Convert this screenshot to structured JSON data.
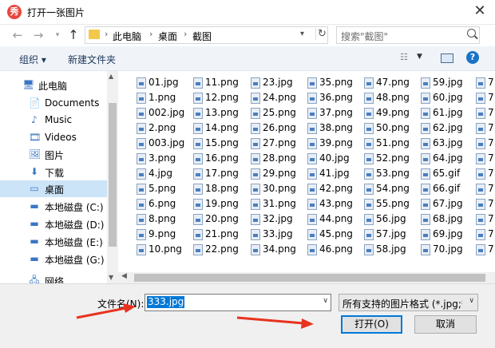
{
  "window": {
    "title": "打开一张图片",
    "app_icon_char": "秀",
    "close_glyph": "✕"
  },
  "address": {
    "crumbs": [
      "此电脑",
      "桌面",
      "截图"
    ]
  },
  "search": {
    "placeholder": "搜索\"截图\""
  },
  "toolbar": {
    "organize": "组织 ▾",
    "new_folder": "新建文件夹",
    "help": "?"
  },
  "sidebar": {
    "items": [
      {
        "label": "此电脑",
        "icon": "computer-icon",
        "glyph": "🖥"
      },
      {
        "label": "Documents",
        "icon": "document-icon",
        "glyph": "📄"
      },
      {
        "label": "Music",
        "icon": "music-icon",
        "glyph": "♪"
      },
      {
        "label": "Videos",
        "icon": "video-icon",
        "glyph": "🎞"
      },
      {
        "label": "图片",
        "icon": "picture-icon",
        "glyph": "🖼"
      },
      {
        "label": "下载",
        "icon": "download-icon",
        "glyph": "⬇"
      },
      {
        "label": "桌面",
        "icon": "desktop-icon",
        "glyph": "▭",
        "selected": true
      },
      {
        "label": "本地磁盘 (C:)",
        "icon": "drive-icon",
        "glyph": "▬"
      },
      {
        "label": "本地磁盘 (D:)",
        "icon": "drive-icon",
        "glyph": "▬"
      },
      {
        "label": "本地磁盘 (E:)",
        "icon": "drive-icon",
        "glyph": "▬"
      },
      {
        "label": "本地磁盘 (G:)",
        "icon": "drive-icon",
        "glyph": "▬"
      },
      {
        "label": "网络",
        "icon": "network-icon",
        "glyph": "🖧"
      }
    ]
  },
  "files": {
    "columns": [
      [
        "01.jpg",
        "1.png",
        "002.jpg",
        "2.png",
        "003.jpg",
        "3.png",
        "4.jpg",
        "5.png",
        "6.png",
        "8.png",
        "9.png",
        "10.png"
      ],
      [
        "11.png",
        "12.png",
        "13.png",
        "14.png",
        "15.png",
        "16.png",
        "17.png",
        "18.png",
        "19.png",
        "20.png",
        "21.png",
        "22.png"
      ],
      [
        "23.jpg",
        "24.png",
        "25.png",
        "26.png",
        "27.png",
        "28.png",
        "29.png",
        "30.png",
        "31.png",
        "32.jpg",
        "33.jpg",
        "34.png"
      ],
      [
        "35.png",
        "36.png",
        "37.png",
        "38.png",
        "39.png",
        "40.jpg",
        "41.jpg",
        "42.png",
        "43.png",
        "44.png",
        "45.png",
        "46.png"
      ],
      [
        "47.png",
        "48.png",
        "49.png",
        "50.png",
        "51.png",
        "52.png",
        "53.png",
        "54.png",
        "55.png",
        "56.jpg",
        "57.jpg",
        "58.jpg"
      ],
      [
        "59.jpg",
        "60.jpg",
        "61.jpg",
        "62.jpg",
        "63.jpg",
        "64.jpg",
        "65.gif",
        "66.gif",
        "67.jpg",
        "68.jpg",
        "69.jpg",
        "70.jpg"
      ],
      [
        "7",
        "7",
        "7",
        "7",
        "7",
        "7",
        "7",
        "7",
        "7",
        "7",
        "7",
        "7"
      ]
    ]
  },
  "bottom": {
    "filename_label": "文件名(N):",
    "filename_value": "333.jpg",
    "filter_label": "所有支持的图片格式 (*.jpg;*.jp",
    "open_button": "打开(O)",
    "cancel_button": "取消"
  },
  "colors": {
    "selection": "#cce4f7",
    "accent": "#0078d7",
    "annotation_arrow": "#e8321f"
  }
}
